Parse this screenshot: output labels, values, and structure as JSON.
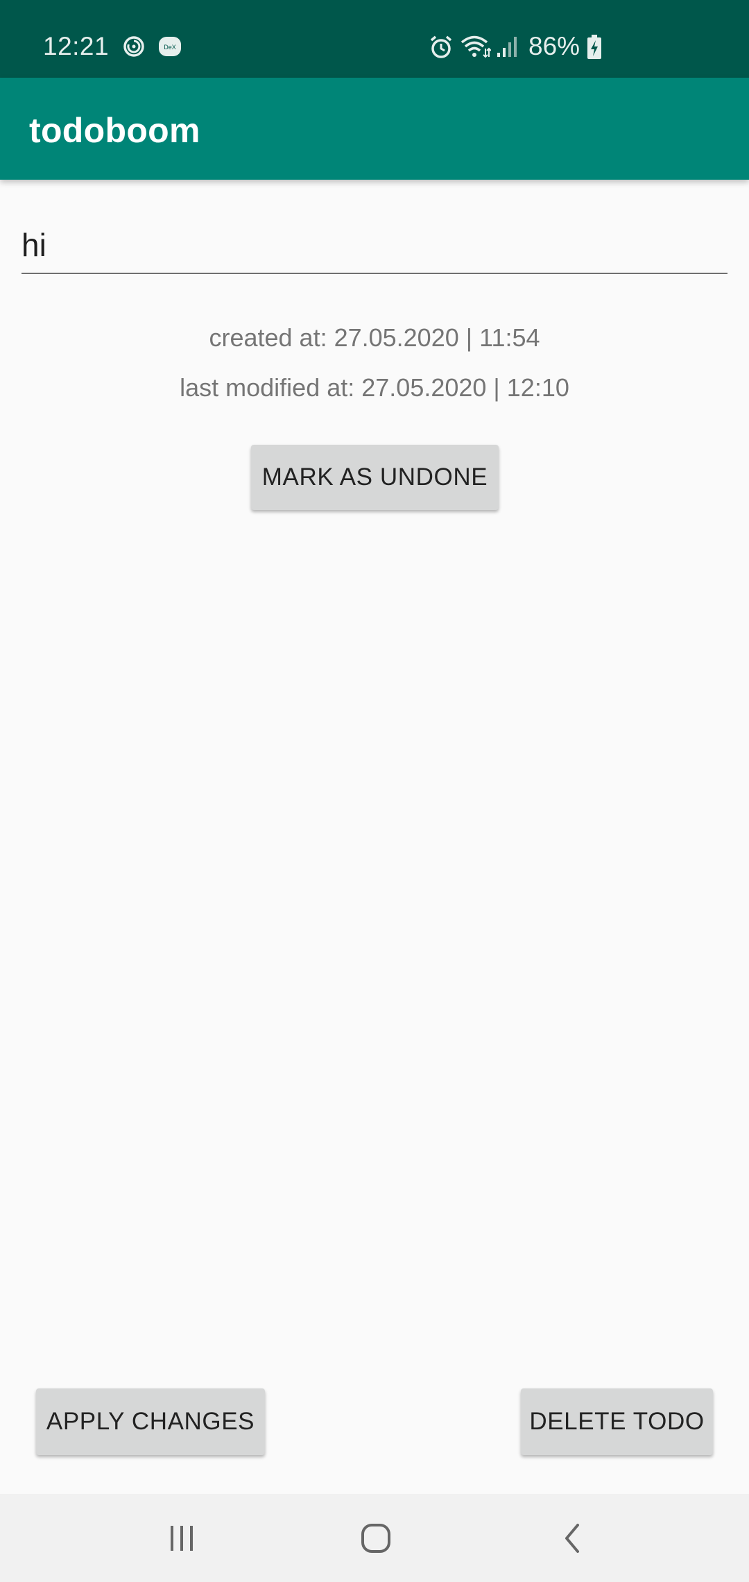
{
  "status_bar": {
    "time": "12:21",
    "battery_percent": "86%",
    "icons": [
      "sync-icon",
      "dex-icon",
      "alarm-icon",
      "wifi-icon",
      "signal-icon",
      "battery-charging-icon"
    ]
  },
  "app_bar": {
    "title": "todoboom"
  },
  "todo": {
    "text_value": "hi",
    "created_at": "created at: 27.05.2020 | 11:54",
    "last_modified_at": "last modified at: 27.05.2020 | 12:10"
  },
  "buttons": {
    "mark_label": "MARK AS UNDONE",
    "apply_label": "APPLY CHANGES",
    "delete_label": "DELETE TODO"
  },
  "nav_bar": {
    "icons": [
      "recents-icon",
      "home-icon",
      "back-icon"
    ]
  },
  "colors": {
    "status_bar": "#00574b",
    "app_bar": "#008577",
    "background": "#fafafa",
    "button": "#d6d7d7"
  }
}
